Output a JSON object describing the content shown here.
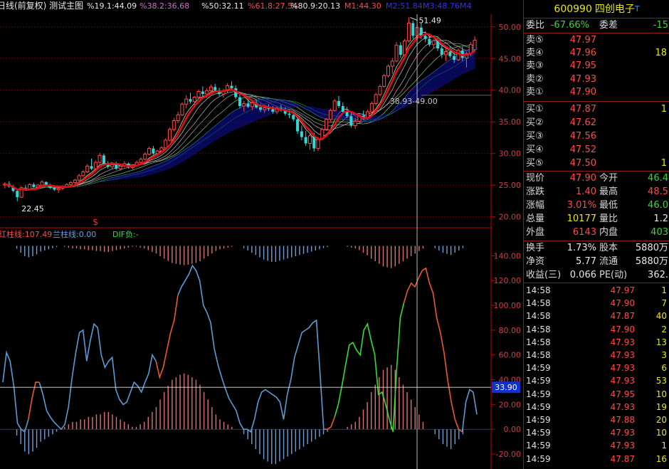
{
  "colors": {
    "up": "#ff4a4a",
    "down": "#2fd7d7",
    "ma": "#e01010",
    "red_bar": "#e07070",
    "blue_bar": "#6aa0d8",
    "orange_line": "#e85a2a",
    "blue_line": "#5b9bd5",
    "green_line": "#33dd33",
    "grid": "#7a0000",
    "axis": "#c00000"
  },
  "chart_header": {
    "title": "日线(前复权) 测试主图",
    "items": [
      {
        "text": "%19.1:44.09",
        "color": "#e8e8e8"
      },
      {
        "text": "%38.2:36.68",
        "color": "#d070d0"
      },
      {
        "text": "%50:32.11",
        "color": "#e8e8e8"
      },
      {
        "text": "%61.8:27.54",
        "color": "#ff4a4a"
      },
      {
        "text": "%80.9:20.13",
        "color": "#e8e8e8"
      },
      {
        "text": "M1:44.30",
        "color": "#ff4a4a"
      },
      {
        "text": "M2:51.84",
        "color": "#3333ee"
      },
      {
        "text": "M3:48.76",
        "color": "#3333ee"
      },
      {
        "text": "M4",
        "color": "#3333ee"
      }
    ]
  },
  "indicator_header": {
    "items": [
      {
        "text": "红柱线:107.49",
        "color": "#ff4a4a"
      },
      {
        "text": "兰柱线:0.00",
        "color": "#6aa0d8"
      },
      {
        "text": "DIF负:-",
        "color": "#33dd33"
      }
    ]
  },
  "chart_data": [
    {
      "type": "candlestick",
      "title": "日线(前复权) 测试主图",
      "ylim": [
        18.5,
        52
      ],
      "y_ticks": [
        20,
        25,
        30,
        35,
        40,
        45,
        50
      ],
      "y_tick_labels": [
        "20.00",
        "25.00",
        "30.00",
        "35.00",
        "40.00",
        "45.00",
        "50.00"
      ],
      "grid": "dotted horizontal",
      "candles": [
        [
          25,
          25.5,
          24.5,
          25.2
        ],
        [
          25.2,
          25.6,
          24.6,
          24.8
        ],
        [
          24.8,
          25,
          23.9,
          24.1
        ],
        [
          24.1,
          24.4,
          22.45,
          23.1
        ],
        [
          23.1,
          24.8,
          23,
          24.6
        ],
        [
          24.6,
          25,
          24.2,
          24.4
        ],
        [
          24.4,
          25.3,
          24.3,
          25.1
        ],
        [
          25.1,
          25.4,
          24.6,
          24.7
        ],
        [
          24.7,
          25.2,
          24.5,
          25
        ],
        [
          25,
          25.8,
          24.9,
          25.5
        ],
        [
          25.5,
          25.6,
          24.8,
          24.9
        ],
        [
          24.9,
          25.2,
          24.4,
          24.6
        ],
        [
          24.6,
          24.9,
          24.1,
          24.3
        ],
        [
          24.3,
          24.7,
          23.8,
          24.5
        ],
        [
          24.5,
          25,
          24.2,
          24.8
        ],
        [
          24.8,
          25.3,
          24.6,
          25.1
        ],
        [
          25.1,
          25.6,
          24.9,
          25.4
        ],
        [
          25.4,
          26,
          25.2,
          25.8
        ],
        [
          25.8,
          26.8,
          25.6,
          26.5
        ],
        [
          26.5,
          27.4,
          26.2,
          27.1
        ],
        [
          27.1,
          28.3,
          26.9,
          28
        ],
        [
          28,
          29.2,
          27.4,
          27.6
        ],
        [
          27.6,
          28.9,
          27.4,
          28.6
        ],
        [
          28.6,
          30.1,
          28.3,
          29.7
        ],
        [
          29.7,
          30,
          28.1,
          28.3
        ],
        [
          28.3,
          28.8,
          27.6,
          27.9
        ],
        [
          27.9,
          28.5,
          27.5,
          28.2
        ],
        [
          28.2,
          28.7,
          27.4,
          27.6
        ],
        [
          27.6,
          28.2,
          27.3,
          28
        ],
        [
          28,
          28.8,
          27.8,
          28.4
        ],
        [
          28.4,
          28.6,
          27.6,
          27.8
        ],
        [
          27.8,
          28.3,
          27.5,
          28.1
        ],
        [
          28.1,
          28.9,
          27.9,
          28.6
        ],
        [
          28.6,
          29.4,
          28.4,
          29.1
        ],
        [
          29.1,
          30.2,
          28.9,
          29.9
        ],
        [
          29.9,
          31.1,
          29.7,
          30.8
        ],
        [
          30.8,
          31.2,
          29.8,
          30
        ],
        [
          30,
          30.6,
          29.5,
          30.4
        ],
        [
          30.4,
          31.2,
          30.2,
          30.9
        ],
        [
          30.9,
          32.4,
          30.7,
          32.1
        ],
        [
          32.1,
          34.1,
          31.9,
          33.8
        ],
        [
          33.8,
          35.6,
          33.5,
          35.2
        ],
        [
          35.2,
          36.6,
          34.8,
          36.1
        ],
        [
          36.1,
          38.1,
          35.9,
          37.8
        ],
        [
          37.8,
          39.2,
          37.1,
          38.6
        ],
        [
          38.6,
          39.6,
          37.9,
          38.2
        ],
        [
          38.2,
          39.1,
          37.6,
          38.9
        ],
        [
          38.9,
          40.1,
          38.7,
          39.8
        ],
        [
          39.8,
          40.6,
          39,
          39.4
        ],
        [
          39.4,
          40.3,
          38.8,
          39.9
        ],
        [
          39.9,
          40.9,
          39.6,
          40.5
        ],
        [
          40.5,
          41,
          39.7,
          40
        ],
        [
          40,
          40.4,
          39.1,
          39.4
        ],
        [
          39.4,
          40.2,
          38.8,
          39.9
        ],
        [
          39.9,
          41.1,
          39.6,
          40.7
        ],
        [
          40.7,
          41.4,
          40.1,
          40.3
        ],
        [
          40.3,
          40.8,
          38.6,
          38.9
        ],
        [
          38.9,
          39.4,
          37.1,
          37.5
        ],
        [
          37.5,
          38.3,
          36.6,
          37.9
        ],
        [
          37.9,
          38.6,
          37.2,
          37.4
        ],
        [
          37.4,
          38.2,
          36.9,
          38
        ],
        [
          38,
          38.5,
          37.1,
          37.3
        ],
        [
          37.3,
          37.8,
          36.6,
          36.9
        ],
        [
          36.9,
          37.6,
          36.4,
          37.2
        ],
        [
          37.2,
          37.8,
          36.7,
          37
        ],
        [
          37,
          37.5,
          36.3,
          36.6
        ],
        [
          36.6,
          37.4,
          36.2,
          37.1
        ],
        [
          37.1,
          37.7,
          36.6,
          36.8
        ],
        [
          36.8,
          37.3,
          36,
          36.3
        ],
        [
          36.3,
          36.9,
          35.6,
          36.1
        ],
        [
          36.1,
          36.5,
          35.1,
          35.4
        ],
        [
          35.4,
          35.9,
          33.1,
          33.5
        ],
        [
          33.5,
          34.4,
          32.1,
          32.6
        ],
        [
          32.6,
          33.6,
          31.2,
          31.6
        ],
        [
          31.6,
          33.1,
          30.6,
          32.8
        ],
        [
          32.8,
          33.3,
          30.3,
          30.8
        ],
        [
          30.8,
          32.6,
          30.4,
          32.3
        ],
        [
          32.3,
          34.1,
          32.1,
          33.8
        ],
        [
          33.8,
          35.6,
          33.6,
          35.4
        ],
        [
          35.4,
          37.1,
          35.1,
          36.8
        ],
        [
          36.8,
          38.6,
          36.6,
          38.3
        ],
        [
          38.3,
          39.1,
          37.2,
          37.5
        ],
        [
          37.5,
          38.1,
          36.3,
          36.6
        ],
        [
          36.6,
          37.4,
          35.6,
          35.9
        ],
        [
          35.9,
          36.5,
          34.1,
          34.4
        ],
        [
          34.4,
          35.6,
          33.9,
          35.1
        ],
        [
          35.1,
          36.3,
          34.9,
          36
        ],
        [
          36,
          36.8,
          35.3,
          35.6
        ],
        [
          35.6,
          36.9,
          35.4,
          36.6
        ],
        [
          36.6,
          38.2,
          36.4,
          37.9
        ],
        [
          37.9,
          39.6,
          37.6,
          39.3
        ],
        [
          39.3,
          40.9,
          39.1,
          40.6
        ],
        [
          40.6,
          42.6,
          40.4,
          42.3
        ],
        [
          42.3,
          44.1,
          42,
          43.8
        ],
        [
          43.8,
          45.1,
          42.6,
          44.6
        ],
        [
          44.6,
          47.6,
          44.4,
          47.1
        ],
        [
          47.1,
          47.6,
          45.1,
          45.6
        ],
        [
          45.6,
          48.1,
          45.4,
          47.8
        ],
        [
          47.8,
          51.49,
          47.5,
          50.6
        ],
        [
          50.6,
          51,
          48.1,
          48.6
        ],
        [
          48.6,
          50.3,
          48.3,
          49.9
        ],
        [
          49.9,
          50.6,
          48.1,
          48.6
        ],
        [
          48.6,
          49.3,
          47.6,
          48.1
        ],
        [
          48.1,
          48.6,
          46.9,
          47.2
        ],
        [
          47.2,
          48.1,
          46.6,
          47.8
        ],
        [
          47.8,
          48.3,
          46.2,
          46.6
        ],
        [
          46.6,
          47.1,
          45.1,
          45.6
        ],
        [
          45.6,
          46.6,
          44.6,
          46.1
        ],
        [
          46.1,
          46.9,
          45.1,
          45.4
        ],
        [
          45.4,
          46.1,
          44.3,
          44.8
        ],
        [
          44.8,
          46.6,
          44.6,
          46.3
        ],
        [
          46.3,
          46.9,
          44.6,
          45.1
        ],
        [
          45.1,
          46.1,
          43.6,
          45.8
        ],
        [
          45.8,
          47.6,
          45.4,
          47.2
        ],
        [
          46.4,
          48.5,
          46,
          47.9
        ]
      ],
      "annotations": [
        "51.49",
        "22.45",
        "38.93-49.00",
        "$"
      ]
    },
    {
      "type": "bar+line",
      "ylim": [
        -28,
        150
      ],
      "y_ticks": [
        -20,
        0,
        20,
        40,
        60,
        80,
        100,
        120,
        140
      ],
      "y_tick_labels": [
        "-20.00",
        "0.00",
        "20.00",
        "40.00",
        "60.00",
        "80.00",
        "100.00",
        "120.00",
        "140.00"
      ],
      "reference_line": {
        "value": 33.9,
        "label": "33.90"
      },
      "line_values": [
        38,
        62,
        55,
        35,
        5,
        0,
        -2,
        8,
        25,
        38,
        38,
        28,
        15,
        10,
        6,
        3,
        0,
        4,
        18,
        42,
        62,
        78,
        80,
        55,
        72,
        85,
        82,
        60,
        50,
        55,
        58,
        32,
        24,
        20,
        22,
        30,
        38,
        35,
        30,
        38,
        45,
        60,
        55,
        42,
        50,
        64,
        78,
        88,
        108,
        115,
        120,
        125,
        132,
        128,
        120,
        100,
        94,
        86,
        65,
        52,
        42,
        33,
        25,
        20,
        15,
        5,
        0,
        0,
        -2,
        8,
        22,
        30,
        32,
        30,
        28,
        26,
        22,
        8,
        28,
        40,
        58,
        68,
        78,
        80,
        82,
        86,
        88,
        45,
        0,
        0,
        2,
        10,
        20,
        35,
        52,
        68,
        70,
        64,
        60,
        80,
        85,
        72,
        60,
        28,
        30,
        20,
        8,
        -2,
        48,
        90,
        102,
        112,
        118,
        115,
        122,
        128,
        130,
        118,
        110,
        90,
        78,
        62,
        40,
        22,
        8,
        0,
        -2,
        22,
        32,
        30,
        12
      ],
      "line_colors": [
        "#5b9bd5",
        "#e85a2a",
        "#5b9bd5",
        "#e85a2a",
        "#5b9bd5",
        "#e85a2a",
        "#33dd33",
        "#e85a2a",
        "#5b9bd5"
      ],
      "line_color_breaks": [
        0,
        7,
        10,
        42,
        48,
        88,
        91,
        110,
        126
      ],
      "bars": [
        0,
        0,
        0,
        -5,
        -12,
        -18,
        -20,
        -18,
        -15,
        -10,
        -8,
        -6,
        -4,
        -2,
        0,
        2,
        4,
        6,
        6,
        8,
        8,
        10,
        10,
        12,
        12,
        14,
        14,
        12,
        10,
        8,
        6,
        4,
        2,
        2,
        4,
        6,
        10,
        14,
        18,
        24,
        30,
        35,
        40,
        42,
        44,
        45,
        44,
        42,
        40,
        36,
        30,
        24,
        18,
        12,
        8,
        6,
        4,
        2,
        0,
        0,
        -4,
        -8,
        -12,
        -16,
        -20,
        -24,
        -26,
        -28,
        -28,
        -26,
        -24,
        -22,
        -20,
        -18,
        -16,
        -14,
        -12,
        -10,
        -8,
        -6,
        -4,
        -2,
        0,
        0,
        0,
        0,
        2,
        4,
        6,
        10,
        16,
        22,
        30,
        36,
        42,
        48,
        50,
        52,
        48,
        42,
        36,
        30,
        24,
        18,
        12,
        6,
        0,
        0,
        -4,
        -8,
        -12,
        -14,
        -16,
        -12,
        -8,
        -4,
        0,
        0,
        0
      ]
    }
  ],
  "quote_panel": {
    "code": "600990",
    "name": "四创电子",
    "name_suffix": "T",
    "wei_bi_label": "委比",
    "wei_bi_value": "-67.66%",
    "wei_cha_label": "委差",
    "wei_cha_value": "-15",
    "asks": [
      {
        "label": "卖⑤",
        "price": "47.97",
        "vol": ""
      },
      {
        "label": "卖④",
        "price": "47.96",
        "vol": "18"
      },
      {
        "label": "卖③",
        "price": "47.95",
        "vol": ""
      },
      {
        "label": "卖②",
        "price": "47.93",
        "vol": ""
      },
      {
        "label": "卖①",
        "price": "47.90",
        "vol": ""
      }
    ],
    "bids": [
      {
        "label": "买①",
        "price": "47.87",
        "vol": "1"
      },
      {
        "label": "买②",
        "price": "47.62",
        "vol": ""
      },
      {
        "label": "买③",
        "price": "47.56",
        "vol": ""
      },
      {
        "label": "买④",
        "price": "47.52",
        "vol": ""
      },
      {
        "label": "买⑤",
        "price": "47.50",
        "vol": "1"
      }
    ],
    "stats": [
      {
        "l1": "现价",
        "v1": "47.90",
        "c1": "red",
        "l2": "今开",
        "v2": "46.4",
        "c2": "green"
      },
      {
        "l1": "涨跌",
        "v1": "1.40",
        "c1": "red",
        "l2": "最高",
        "v2": "48.5",
        "c2": "red"
      },
      {
        "l1": "涨幅",
        "v1": "3.01%",
        "c1": "red",
        "l2": "最低",
        "v2": "46.0",
        "c2": "green"
      },
      {
        "l1": "总量",
        "v1": "10177",
        "c1": "yellow",
        "l2": "量比",
        "v2": "1.2",
        "c2": "white"
      },
      {
        "l1": "外盘",
        "v1": "6143",
        "c1": "red",
        "l2": "内盘",
        "v2": "403",
        "c2": "green"
      }
    ],
    "fin": [
      {
        "l1": "换手",
        "v1": "1.73%",
        "l2": "股本",
        "v2": "5880万"
      },
      {
        "l1": "净资",
        "v1": "5.77",
        "l2": "流通",
        "v2": "5880万"
      },
      {
        "l1": "收益(三)",
        "v1": "0.066",
        "l2": "PE(动)",
        "v2": "362."
      }
    ],
    "ticks": [
      {
        "time": "14:58",
        "price": "47.97",
        "vol": "1",
        "dir": "S"
      },
      {
        "time": "14:58",
        "price": "47.90",
        "vol": "7",
        "dir": "S"
      },
      {
        "time": "14:58",
        "price": "47.87",
        "vol": "40",
        "dir": "S"
      },
      {
        "time": "14:58",
        "price": "47.90",
        "vol": "2",
        "dir": "S"
      },
      {
        "time": "14:58",
        "price": "47.93",
        "vol": "13",
        "dir": "B"
      },
      {
        "time": "14:58",
        "price": "47.93",
        "vol": "3",
        "dir": "B"
      },
      {
        "time": "14:59",
        "price": "47.93",
        "vol": "6",
        "dir": "B"
      },
      {
        "time": "14:59",
        "price": "47.93",
        "vol": "53",
        "dir": "B"
      },
      {
        "time": "14:59",
        "price": "47.95",
        "vol": "10",
        "dir": "B"
      },
      {
        "time": "14:59",
        "price": "47.93",
        "vol": "19",
        "dir": "S"
      },
      {
        "time": "14:59",
        "price": "47.88",
        "vol": "20",
        "dir": "S"
      },
      {
        "time": "14:59",
        "price": "47.93",
        "vol": "10",
        "dir": "B"
      },
      {
        "time": "14:59",
        "price": "47.93",
        "vol": "1",
        "dir": "S"
      },
      {
        "time": "14:59",
        "price": "47.87",
        "vol": "16",
        "dir": "S"
      }
    ]
  }
}
